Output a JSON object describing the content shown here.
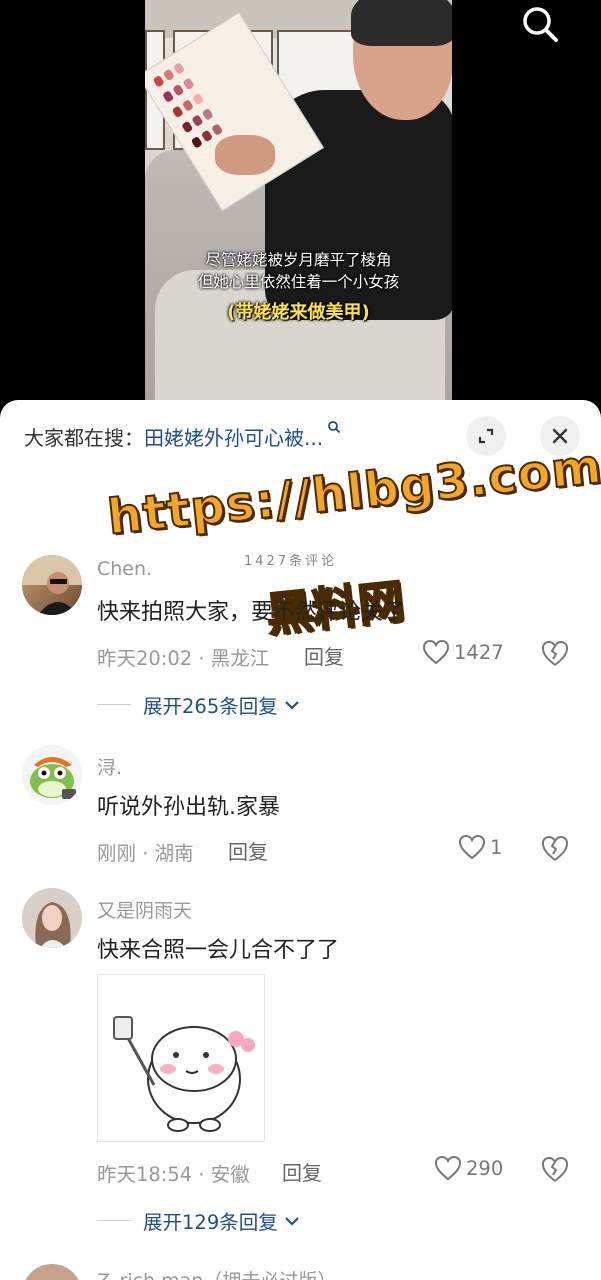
{
  "video": {
    "subtitle_line1": "尽管姥姥被岁月磨平了棱角",
    "subtitle_line2": "但她心里依然住着一个小女孩",
    "subtitle_tag": "(带姥姥来做美甲)"
  },
  "sheet": {
    "hot_search_label": "大家都在搜：",
    "hot_search_term": "田姥姥外孙可心被...",
    "watermark_url": "https://hlbg3.com",
    "watermark_name": "黑料网",
    "partial_text": "1427条评论"
  },
  "comments": [
    {
      "username": "Chen.",
      "text": "快来拍照大家，要不然评论关了",
      "meta": "昨天20:02 · 黑龙江",
      "reply_label": "回复",
      "likes": "1427",
      "expand_label": "展开265条回复"
    },
    {
      "username": "浔.",
      "text": "听说外孙出轨.家暴",
      "meta": "刚刚 · 湖南",
      "reply_label": "回复",
      "likes": "1"
    },
    {
      "username": "又是阴雨天",
      "text": "快来合照一会儿合不了了",
      "meta": "昨天18:54 · 安徽",
      "reply_label": "回复",
      "likes": "290",
      "expand_label": "展开129条回复"
    },
    {
      "username": "Z_rich.man（拥去必过版）"
    }
  ],
  "icons": {
    "search": "search-icon",
    "expand": "expand-icon",
    "close": "close-icon",
    "heart": "heart-icon",
    "dislike": "broken-heart-icon",
    "chevron": "chevron-down-icon"
  },
  "colors": {
    "link_blue": "#1f4e8c",
    "watermark_orange": "#f5a623",
    "subtitle_yellow": "#ffe34a"
  }
}
